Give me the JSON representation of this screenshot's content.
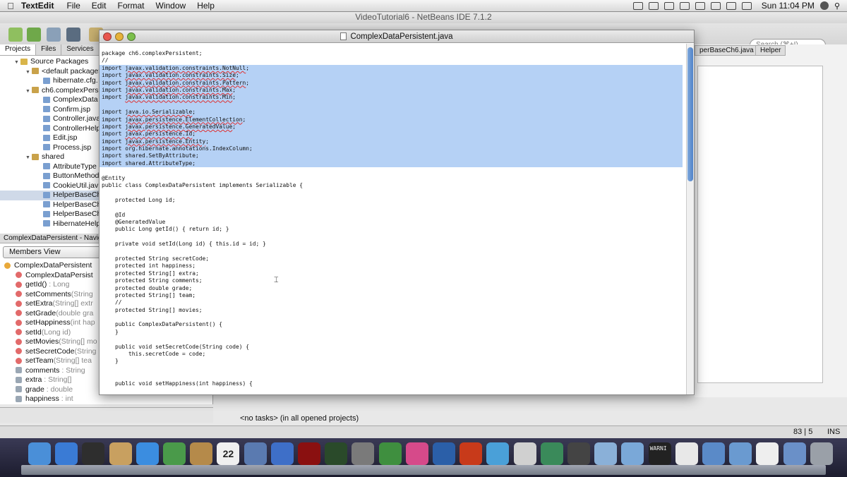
{
  "menubar": {
    "app": "TextEdit",
    "items": [
      "File",
      "Edit",
      "Format",
      "Window",
      "Help"
    ],
    "clock": "Sun 11:04 PM"
  },
  "netbeans": {
    "title": "VideoTutorial6 - NetBeans IDE 7.1.2",
    "search_placeholder": "Search (⌘+I)",
    "tabs": [
      "Projects",
      "Files",
      "Services"
    ],
    "tree": [
      {
        "label": "Source Packages",
        "depth": 1,
        "icon": "folder-icon"
      },
      {
        "label": "<default package>",
        "depth": 2,
        "icon": "package-icon"
      },
      {
        "label": "hibernate.cfg.",
        "depth": 3,
        "icon": "file-icon"
      },
      {
        "label": "ch6.complexPers",
        "depth": 2,
        "icon": "package-icon"
      },
      {
        "label": "ComplexData",
        "depth": 3,
        "icon": "file-icon"
      },
      {
        "label": "Confirm.jsp",
        "depth": 3,
        "icon": "file-icon"
      },
      {
        "label": "Controller.java",
        "depth": 3,
        "icon": "file-icon"
      },
      {
        "label": "ControllerHelp",
        "depth": 3,
        "icon": "file-icon"
      },
      {
        "label": "Edit.jsp",
        "depth": 3,
        "icon": "file-icon"
      },
      {
        "label": "Process.jsp",
        "depth": 3,
        "icon": "file-icon"
      },
      {
        "label": "shared",
        "depth": 2,
        "icon": "package-icon"
      },
      {
        "label": "AttributeType",
        "depth": 3,
        "icon": "file-icon"
      },
      {
        "label": "ButtonMethod",
        "depth": 3,
        "icon": "file-icon"
      },
      {
        "label": "CookieUtil.jav",
        "depth": 3,
        "icon": "file-icon"
      },
      {
        "label": "HelperBaseCh",
        "depth": 3,
        "icon": "file-icon",
        "selected": true
      },
      {
        "label": "HelperBaseCh",
        "depth": 3,
        "icon": "file-icon"
      },
      {
        "label": "HelperBaseCh",
        "depth": 3,
        "icon": "file-icon"
      },
      {
        "label": "HibernateHelp",
        "depth": 3,
        "icon": "file-icon"
      }
    ],
    "navigator_title": "ComplexDataPersistent - Navigat",
    "members_view": "Members View",
    "members": [
      {
        "name": "ComplexDataPersistent",
        "type": "",
        "kind": "class"
      },
      {
        "name": "ComplexDataPersist",
        "type": "",
        "kind": "ctor"
      },
      {
        "name": "getId()",
        "type": " : Long",
        "kind": "method"
      },
      {
        "name": "setComments",
        "type": "(String",
        "kind": "method"
      },
      {
        "name": "setExtra",
        "type": "(String[] extr",
        "kind": "method"
      },
      {
        "name": "setGrade",
        "type": "(double gra",
        "kind": "method"
      },
      {
        "name": "setHappiness",
        "type": "(int hap",
        "kind": "method"
      },
      {
        "name": "setId",
        "type": "(Long id)",
        "kind": "private"
      },
      {
        "name": "setMovies",
        "type": "(String[] mo",
        "kind": "method"
      },
      {
        "name": "setSecretCode",
        "type": "(String",
        "kind": "method"
      },
      {
        "name": "setTeam",
        "type": "(String[] tea",
        "kind": "method"
      },
      {
        "name": "comments",
        "type": " : String",
        "kind": "field"
      },
      {
        "name": "extra",
        "type": " : String[]",
        "kind": "field"
      },
      {
        "name": "grade",
        "type": " : double",
        "kind": "field"
      },
      {
        "name": "happiness",
        "type": " : int",
        "kind": "field"
      }
    ],
    "right_tabs": [
      "perBaseCh6.java",
      "Helper"
    ],
    "tasks_text": "<no tasks>   (in all opened projects)",
    "status_pos": "83 | 5",
    "status_mode": "INS"
  },
  "textedit": {
    "title": "ComplexDataPersistent.java",
    "lines": [
      {
        "t": "package ch6.complexPersistent;",
        "hl": false
      },
      {
        "t": "//",
        "hl": false
      },
      {
        "t": "import ",
        "sq": "javax.validation.constraints.NotNull",
        "rest": ";",
        "hl": true
      },
      {
        "t": "import ",
        "sq": "javax.validation.constraints.Size",
        "rest": ";",
        "hl": true
      },
      {
        "t": "import ",
        "sq": "javax.validation.constraints.Pattern",
        "rest": ";",
        "hl": true
      },
      {
        "t": "import ",
        "sq": "javax.validation.constraints.Max",
        "rest": ";",
        "hl": true
      },
      {
        "t": "import ",
        "sq": "javax.validation.constraints.Min",
        "rest": ";",
        "hl": true
      },
      {
        "t": "",
        "hl": true
      },
      {
        "t": "import ",
        "sq": "java.io.Serializable",
        "rest": ";",
        "hl": true
      },
      {
        "t": "import ",
        "sq": "javax.persistence.ElementCollection",
        "rest": ";",
        "hl": true
      },
      {
        "t": "import ",
        "sq": "javax.persistence.GeneratedValue",
        "rest": ";",
        "hl": true
      },
      {
        "t": "import ",
        "sq": "javax.persistence.Id",
        "rest": ";",
        "hl": true
      },
      {
        "t": "import ",
        "sq": "javax.persistence.Entity",
        "rest": ";",
        "hl": true
      },
      {
        "t": "import org.hibernate.annotations.IndexColumn;",
        "hl": true
      },
      {
        "t": "import shared.SetByAttribute;",
        "hl": true
      },
      {
        "t": "import shared.AttributeType;",
        "hl": true
      },
      {
        "t": "",
        "hl": false
      },
      {
        "t": "@Entity",
        "hl": false
      },
      {
        "t": "public class ComplexDataPersistent implements Serializable {",
        "hl": false
      },
      {
        "t": "",
        "hl": false
      },
      {
        "t": "    protected Long id;",
        "hl": false
      },
      {
        "t": "",
        "hl": false
      },
      {
        "t": "    @Id",
        "hl": false
      },
      {
        "t": "    @GeneratedValue",
        "hl": false
      },
      {
        "t": "    public Long getId() { return id; }",
        "hl": false
      },
      {
        "t": "",
        "hl": false
      },
      {
        "t": "    private void setId(Long id) { this.id = id; }",
        "hl": false
      },
      {
        "t": "",
        "hl": false
      },
      {
        "t": "    protected String secretCode;",
        "hl": false
      },
      {
        "t": "    protected int happiness;",
        "hl": false
      },
      {
        "t": "    protected String[] extra;",
        "hl": false
      },
      {
        "t": "    protected String comments;",
        "hl": false
      },
      {
        "t": "    protected double grade;",
        "hl": false
      },
      {
        "t": "    protected String[] team;",
        "hl": false
      },
      {
        "t": "    //",
        "hl": false
      },
      {
        "t": "    protected String[] movies;",
        "hl": false
      },
      {
        "t": "",
        "hl": false
      },
      {
        "t": "    public ComplexDataPersistent() {",
        "hl": false
      },
      {
        "t": "    }",
        "hl": false
      },
      {
        "t": "",
        "hl": false
      },
      {
        "t": "    public void setSecretCode(String code) {",
        "hl": false
      },
      {
        "t": "        this.secretCode = code;",
        "hl": false
      },
      {
        "t": "    }",
        "hl": false
      },
      {
        "t": "",
        "hl": false
      },
      {
        "t": "",
        "hl": false
      },
      {
        "t": "    public void setHappiness(int happiness) {",
        "hl": false
      }
    ]
  },
  "colors": {
    "selection": "#b5d1f5",
    "squiggle": "#e03030",
    "close": "#e8564f",
    "minimize": "#e6b23a",
    "zoom": "#7bbf4a"
  },
  "dock": {
    "icons": [
      "finder-icon",
      "appstore-icon",
      "dashboard-icon",
      "mail-stamp-icon",
      "safari-icon",
      "facetime-icon",
      "contacts-icon",
      "calendar-icon",
      "iphoto-icon",
      "itunes-icon",
      "photobooth-icon",
      "timemachine-icon",
      "systemprefs-icon",
      "dreamweaver-icon",
      "fireworks-icon",
      "photoshop-icon",
      "flash-icon",
      "messenger-icon",
      "app-icon",
      "workbench-icon",
      "imovie-icon",
      "preview-icon",
      "virtualbox-icon",
      "console-icon",
      "textedit-icon",
      "applications-folder-icon",
      "documents-folder-icon",
      "file-icon",
      "downloads-icon",
      "trash-icon"
    ],
    "calendar_day": "22",
    "console_text": "WARNI"
  }
}
